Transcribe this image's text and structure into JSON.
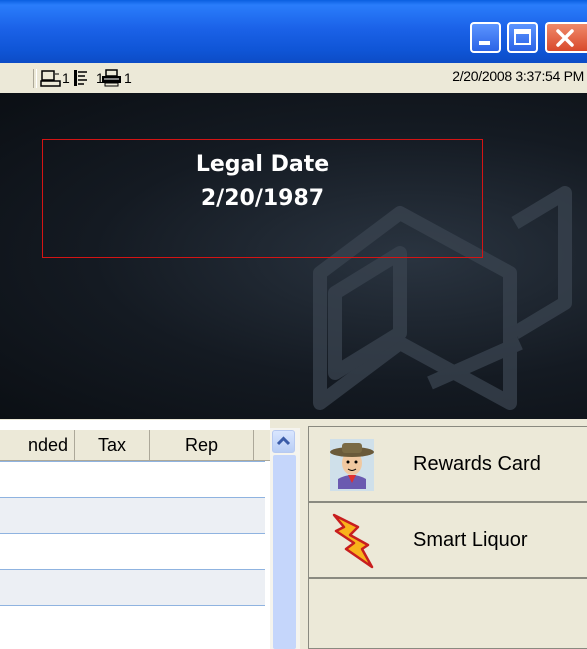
{
  "window": {
    "controls": [
      "minimize",
      "maximize",
      "close"
    ]
  },
  "status_bar": {
    "indicators": [
      {
        "icon": "register-icon",
        "count": "1"
      },
      {
        "icon": "journal-icon",
        "count": "1"
      },
      {
        "icon": "printer-icon",
        "count": "1"
      }
    ],
    "datetime": "2/20/2008 3:37:54 PM"
  },
  "banner": {
    "legal_label": "Legal Date",
    "legal_date": "2/20/1987",
    "colors": {
      "box_border": "#d41414",
      "text": "#ffffff"
    }
  },
  "transaction_grid": {
    "columns": [
      "nded",
      "Tax",
      "Rep"
    ]
  },
  "side_panel": {
    "buttons": [
      {
        "label": "Rewards Card",
        "icon": "cowboy-avatar-icon"
      },
      {
        "label": "Smart Liquor",
        "icon": "lightning-bolt-icon"
      }
    ]
  }
}
